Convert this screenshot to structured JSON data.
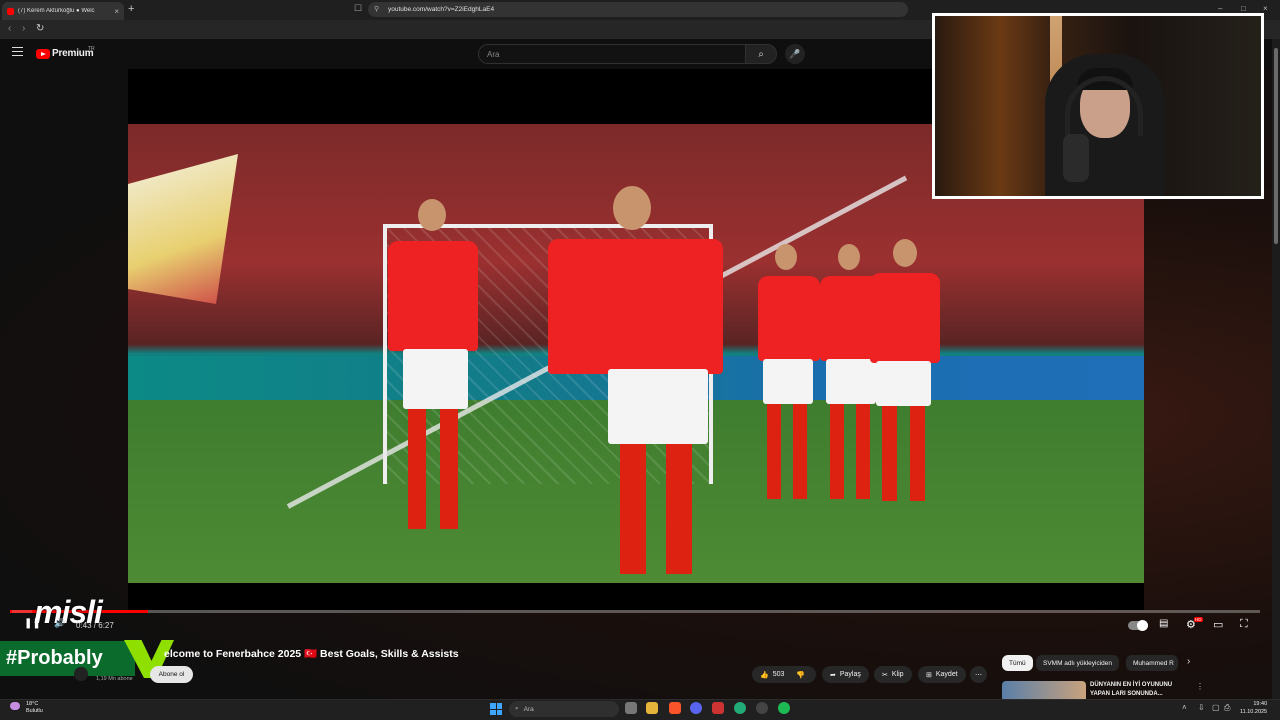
{
  "browser": {
    "tab_title": "(7) Kerem Aktürkoğlu ● Welc",
    "tab_close": "×",
    "new_tab": "+",
    "url": "youtube.com/watch?v=Z2iEdghLaE4",
    "nav_back": "‹",
    "nav_forward": "›",
    "reload": "↻",
    "win_min": "–",
    "win_max": "□",
    "win_close": "×"
  },
  "youtube": {
    "brand": "Premium",
    "country": "TR",
    "search_placeholder": "Ara",
    "search_icon": "⌕",
    "mic_icon": "🎤"
  },
  "overlay": {
    "sponsor": "misli",
    "hashtag": "#Probably"
  },
  "player": {
    "time": "0:43 / 6:27",
    "progress_fraction": 0.11,
    "pause_icon": "❚❚",
    "volume_icon": "🔊",
    "next_icon": "⏭",
    "autoplay_icon": "▶",
    "captions_icon": "▤",
    "settings_icon": "⚙",
    "settings_badge": "HD",
    "theater_icon": "▭",
    "fullscreen_icon": "⛶"
  },
  "video": {
    "title": "elcome to Fenerbahce 2025 🇹🇷 Best Goals, Skills & Assists",
    "channel_subs": "1,19 Mn abone",
    "subscribe": "Abone ol",
    "likes": "503",
    "share": "Paylaş",
    "clip": "Klip",
    "save": "Kaydet",
    "more": "⋯"
  },
  "chips": [
    "Tümü",
    "SVMM adlı yükleyiciden",
    "Muhammed R"
  ],
  "chip_next": "›",
  "recommended": {
    "title": "DÜNYANIN EN İYİ OYUNUNU YAPAN LARI SONUNDA..."
  },
  "taskbar": {
    "temp": "18°C",
    "weather": "Bulutlu",
    "search_placeholder": "Ara",
    "time": "19:40",
    "date": "11.10.2025"
  },
  "colors": {
    "youtube_red": "#ff0000",
    "benfica_red": "#e22222",
    "probably_green": "#0b6b2d"
  }
}
